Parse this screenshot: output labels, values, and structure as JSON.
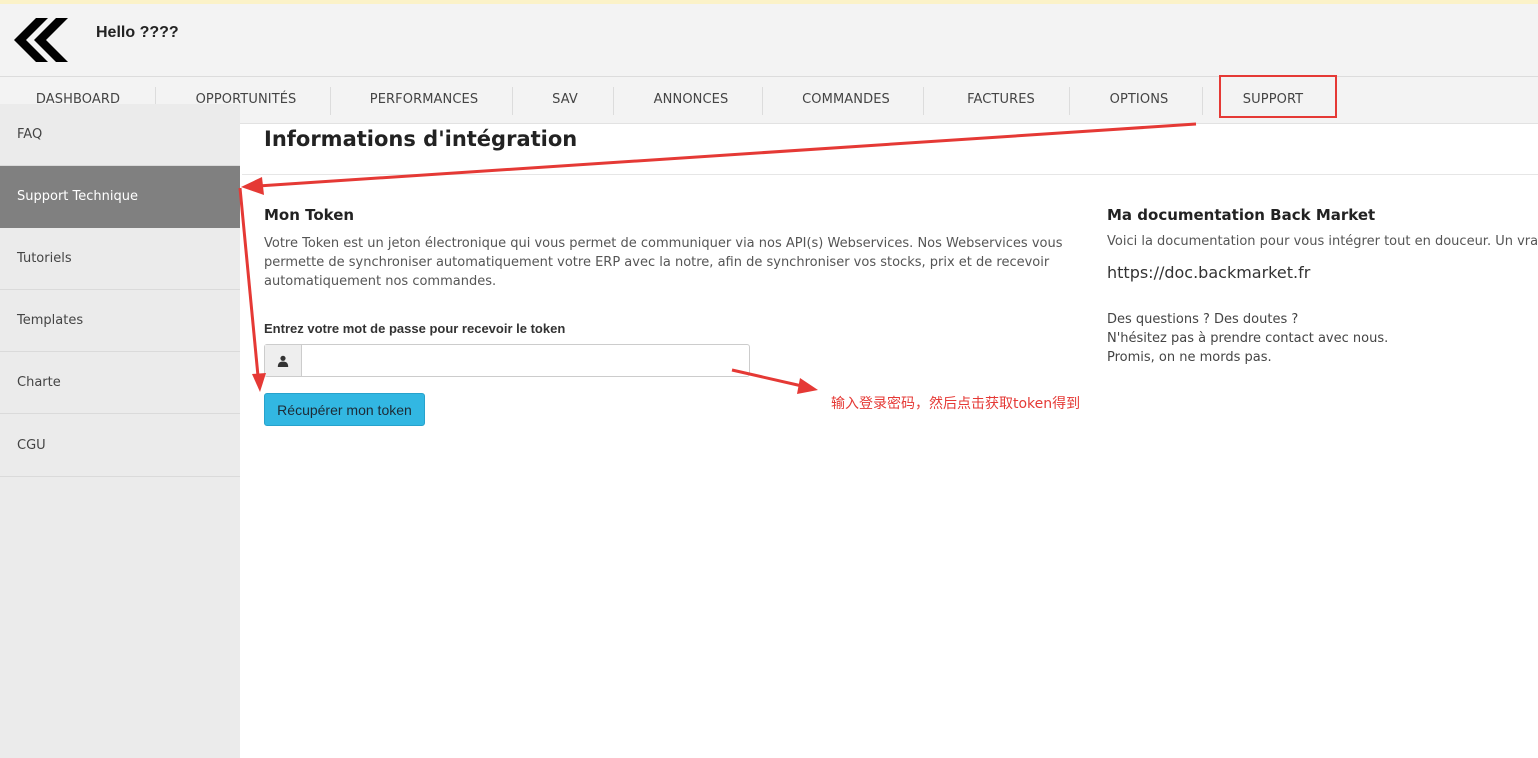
{
  "header": {
    "greeting": "Hello ????"
  },
  "nav": {
    "items": [
      {
        "label": "DASHBOARD"
      },
      {
        "label": "OPPORTUNITÉS"
      },
      {
        "label": "PERFORMANCES"
      },
      {
        "label": "SAV"
      },
      {
        "label": "ANNONCES"
      },
      {
        "label": "COMMANDES"
      },
      {
        "label": "FACTURES"
      },
      {
        "label": "OPTIONS"
      },
      {
        "label": "SUPPORT"
      }
    ]
  },
  "sidebar": {
    "items": [
      {
        "label": "FAQ"
      },
      {
        "label": "Support Technique"
      },
      {
        "label": "Tutoriels"
      },
      {
        "label": "Templates"
      },
      {
        "label": "Charte"
      },
      {
        "label": "CGU"
      }
    ],
    "active_index": 1
  },
  "main": {
    "title": "Informations d'intégration",
    "token": {
      "heading": "Mon Token",
      "description": "Votre Token est un jeton électronique qui vous permet de communiquer via nos API(s) Webservices. Nos Webservices vous permette de synchroniser automatiquement votre ERP avec la notre, afin de synchroniser vos stocks, prix et de recevoir automatiquement nos commandes.",
      "password_label": "Entrez votre mot de passe pour recevoir le token",
      "password_value": "",
      "button_label": "Récupérer mon token"
    },
    "doc": {
      "heading": "Ma documentation Back Market",
      "description": "Voici la documentation pour vous intégrer tout en douceur. Un vrai p",
      "link": "https://doc.backmarket.fr",
      "questions_1": "Des questions ? Des doutes ?",
      "questions_2": "N'hésitez pas à prendre contact avec nous.",
      "questions_3": "Promis, on ne mords pas."
    }
  },
  "annotation": {
    "text": "输入登录密码，然后点击获取token得到"
  },
  "colors": {
    "annotation_red": "#e53935",
    "button_blue": "#32b7e2",
    "sidebar_active": "#808080",
    "sidebar_bg": "#ebebeb",
    "nav_bg": "#f3f3f3"
  },
  "icons": {
    "logo": "double-chevron-left-icon",
    "password_addon": "user-icon"
  }
}
